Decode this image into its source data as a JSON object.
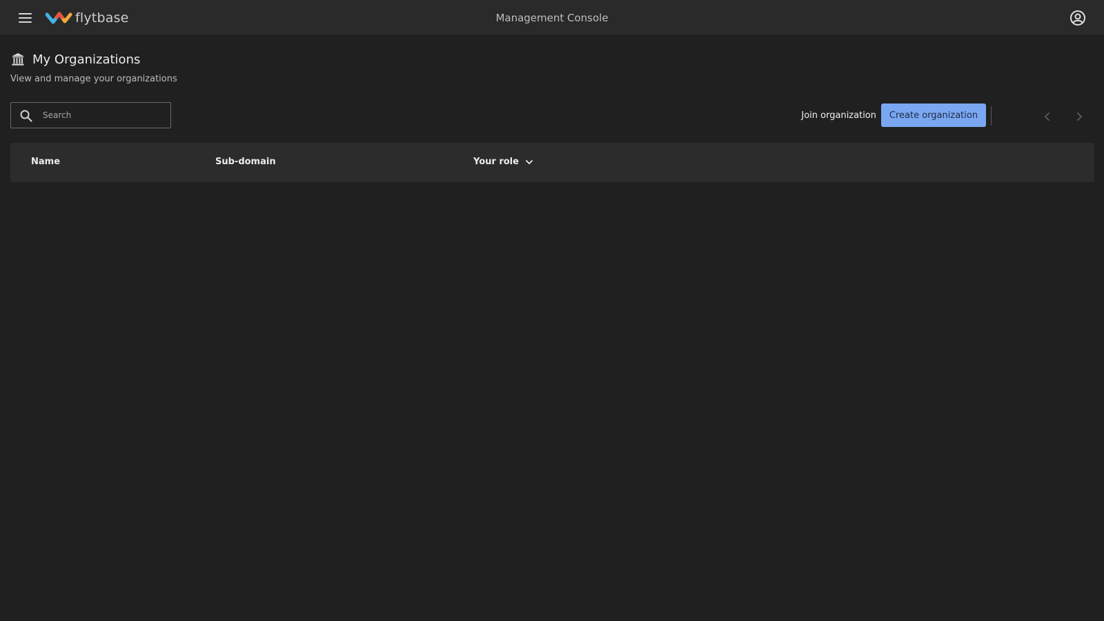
{
  "topbar": {
    "brand": "flytbase",
    "title": "Management Console",
    "menu_icon": "hamburger-menu-icon",
    "account_icon": "account-circle-icon"
  },
  "page": {
    "title": "My Organizations",
    "subtitle": "View and manage your organizations",
    "title_icon": "bank-building-icon"
  },
  "search": {
    "placeholder": "Search",
    "value": ""
  },
  "actions": {
    "join_label": "Join organization",
    "create_label": "Create organization"
  },
  "table": {
    "columns": [
      "Name",
      "Sub-domain",
      "Your role"
    ],
    "rows": []
  },
  "colors": {
    "accent": "#7aa7f2",
    "background": "#202020",
    "topbar": "#2a2a2a",
    "table_header": "#2c2c2c"
  }
}
